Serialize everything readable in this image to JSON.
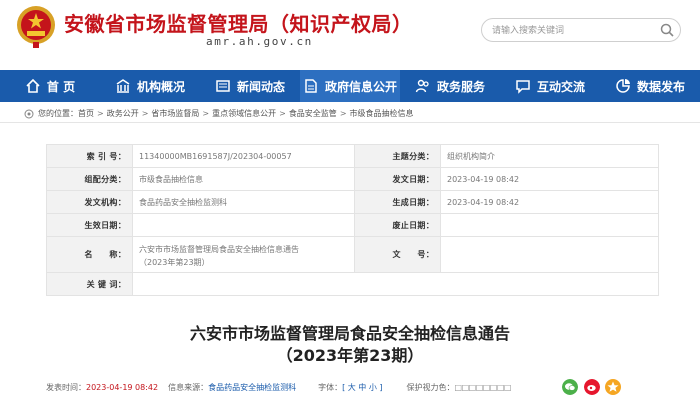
{
  "header": {
    "title": "安徽省市场监督管理局（知识产权局）",
    "url": "amr.ah.gov.cn",
    "search_placeholder": "请输入搜索关键词"
  },
  "nav": {
    "items": [
      {
        "label": "首 页",
        "icon": "home-icon"
      },
      {
        "label": "机构概况",
        "icon": "building-icon"
      },
      {
        "label": "新闻动态",
        "icon": "news-icon"
      },
      {
        "label": "政府信息公开",
        "icon": "document-icon",
        "active": true
      },
      {
        "label": "政务服务",
        "icon": "people-icon"
      },
      {
        "label": "互动交流",
        "icon": "chat-icon"
      },
      {
        "label": "数据发布",
        "icon": "chart-icon"
      }
    ]
  },
  "breadcrumb": {
    "prefix": "您的位置：",
    "items": [
      "首页",
      "政务公开",
      "省市场监督局",
      "重点领域信息公开",
      "食品安全监管",
      "市级食品抽检信息"
    ]
  },
  "info": {
    "index_label": "索 引 号：",
    "index_value": "11340000MB1691587J/202304-00057",
    "theme_label": "主题分类：",
    "theme_value": "组织机构简介",
    "group_label": "组配分类：",
    "group_value": "市级食品抽检信息",
    "issue_date_label": "发文日期：",
    "issue_date_value": "2023-04-19 08:42",
    "issuer_label": "发文机构：",
    "issuer_value": "食品药品安全抽检监测科",
    "create_date_label": "生成日期：",
    "create_date_value": "2023-04-19 08:42",
    "effective_label": "生效日期：",
    "effective_value": "",
    "invalid_label": "废止日期：",
    "invalid_value": "",
    "name_label": "名　　称：",
    "name_value_1": "六安市市场监督管理局食品安全抽检信息通告",
    "name_value_2": "（2023年第23期）",
    "docno_label": "文　　号：",
    "docno_value": "",
    "keywords_label": "关 键 词：",
    "keywords_value": ""
  },
  "article": {
    "title_line1": "六安市市场监督管理局食品安全抽检信息通告",
    "title_line2": "（2023年第23期）"
  },
  "meta": {
    "time_label": "发表时间：",
    "time_value": "2023-04-19 08:42",
    "source_label": "信息来源：",
    "source_value": "食品药品安全抽检监测科",
    "font_label": "字体：",
    "font_value": "[ 大 中 小 ]",
    "vision_label": "保护视力色：",
    "vision_boxes": "□□□□□□□□"
  },
  "colors": {
    "brand_red": "#c4141b",
    "nav_blue": "#1a5bab",
    "wechat_green": "#4cb04a",
    "weibo_red": "#e6162d",
    "favorite_orange": "#f5a623"
  }
}
